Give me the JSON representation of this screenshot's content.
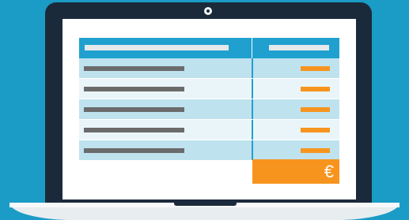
{
  "colors": {
    "background": "#1a9cc6",
    "laptop_frame": "#1b2a3b",
    "table_header": "#1fa0cf",
    "row_dark": "#bfe2ef",
    "row_light": "#eaf5fa",
    "accent_orange": "#f7941e",
    "placeholder_text_bar": "#6b6b6b"
  },
  "table": {
    "rows": [
      {
        "stripe": "odd"
      },
      {
        "stripe": "even"
      },
      {
        "stripe": "odd"
      },
      {
        "stripe": "even"
      },
      {
        "stripe": "odd"
      }
    ]
  },
  "total": {
    "currency_symbol": "€"
  }
}
